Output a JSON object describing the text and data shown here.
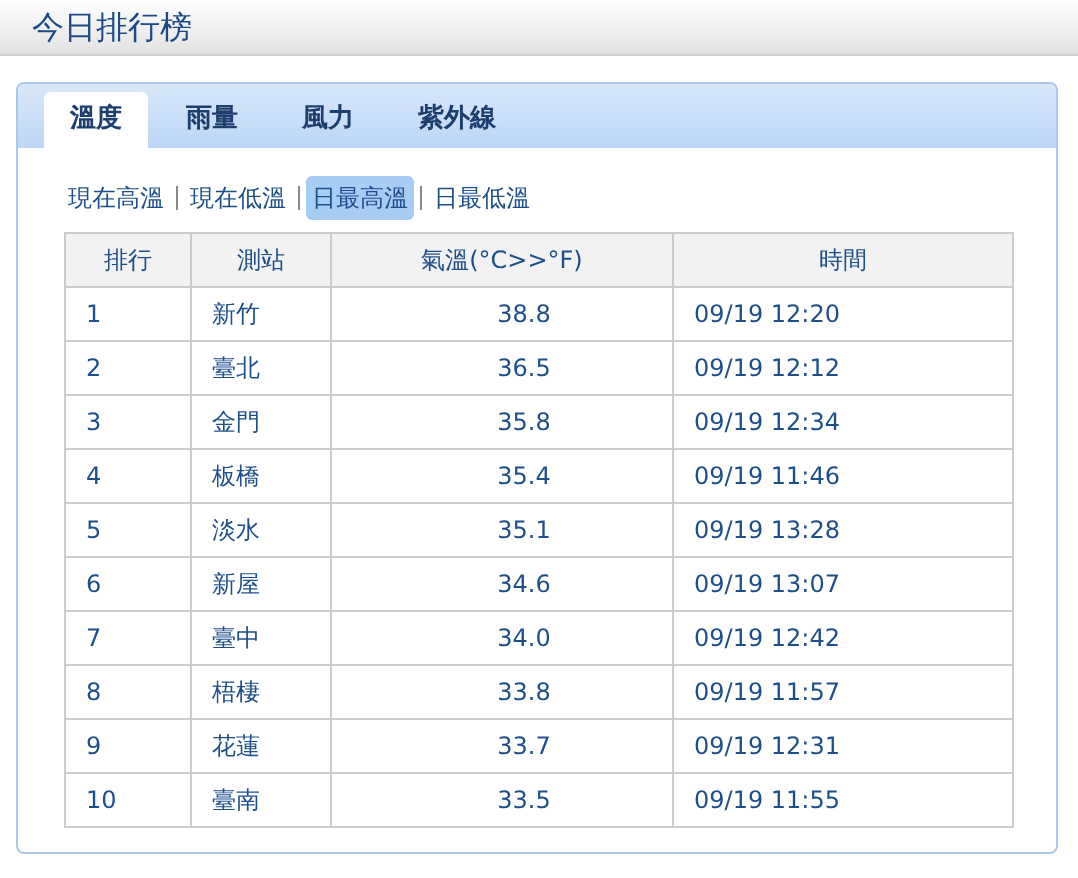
{
  "title": "今日排行榜",
  "tabs": [
    {
      "label": "溫度",
      "selected": true
    },
    {
      "label": "雨量",
      "selected": false
    },
    {
      "label": "風力",
      "selected": false
    },
    {
      "label": "紫外線",
      "selected": false
    }
  ],
  "subtabs": [
    {
      "label": "現在高溫",
      "selected": false
    },
    {
      "label": "現在低溫",
      "selected": false
    },
    {
      "label": "日最高溫",
      "selected": true
    },
    {
      "label": "日最低溫",
      "selected": false
    }
  ],
  "table": {
    "columns": [
      "排行",
      "測站",
      "氣溫(°C>>°F)",
      "時間"
    ],
    "rows": [
      [
        "1",
        "新竹",
        "38.8",
        "09/19 12:20"
      ],
      [
        "2",
        "臺北",
        "36.5",
        "09/19 12:12"
      ],
      [
        "3",
        "金門",
        "35.8",
        "09/19 12:34"
      ],
      [
        "4",
        "板橋",
        "35.4",
        "09/19 11:46"
      ],
      [
        "5",
        "淡水",
        "35.1",
        "09/19 13:28"
      ],
      [
        "6",
        "新屋",
        "34.6",
        "09/19 13:07"
      ],
      [
        "7",
        "臺中",
        "34.0",
        "09/19 12:42"
      ],
      [
        "8",
        "梧棲",
        "33.8",
        "09/19 11:57"
      ],
      [
        "9",
        "花蓮",
        "33.7",
        "09/19 12:31"
      ],
      [
        "10",
        "臺南",
        "33.5",
        "09/19 11:55"
      ]
    ]
  }
}
